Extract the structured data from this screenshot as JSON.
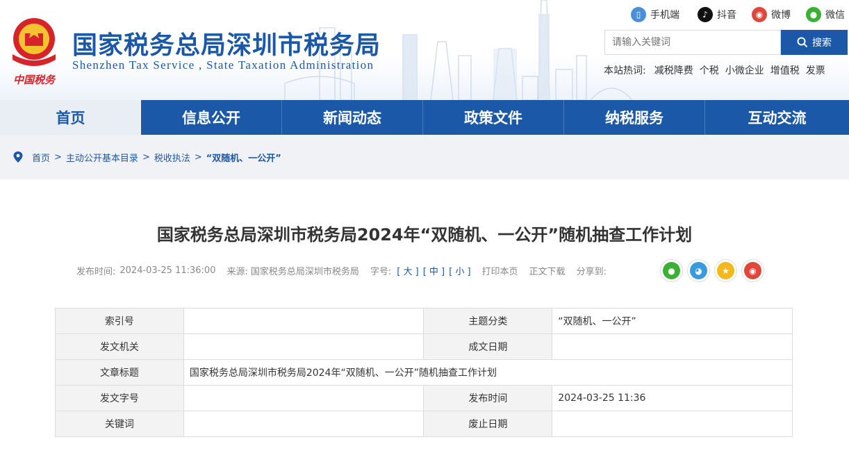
{
  "header": {
    "emblem_text": "中国税务",
    "site_name_cn": "国家税务总局深圳市税务局",
    "site_name_en": "Shenzhen  Tax  Service ,  State  Taxation  Administration",
    "social": [
      {
        "label": "手机端",
        "icon": "mobile-icon",
        "color": "#4a90d9"
      },
      {
        "label": "抖音",
        "icon": "douyin-icon",
        "color": "#111111"
      },
      {
        "label": "微博",
        "icon": "weibo-icon",
        "color": "#e0463a"
      },
      {
        "label": "微信",
        "icon": "wechat-icon",
        "color": "#3cb034"
      }
    ],
    "search": {
      "placeholder": "请输入关键词",
      "button_label": "搜索"
    },
    "hot": {
      "label": "本站热词:",
      "items": [
        "减税降费",
        "个税",
        "小微企业",
        "增值税",
        "发票"
      ]
    }
  },
  "nav": {
    "items": [
      "首页",
      "信息公开",
      "新闻动态",
      "政策文件",
      "纳税服务",
      "互动交流"
    ],
    "active_index": 0
  },
  "breadcrumb": {
    "items": [
      "首页",
      "主动公开基本目录",
      "税收执法",
      "“双随机、一公开”"
    ],
    "separator": ">"
  },
  "article": {
    "title": "国家税务总局深圳市税务局2024年“双随机、一公开”随机抽查工作计划",
    "publish_label": "发布时间:",
    "publish_time": "2024-03-25 11:36:00",
    "source_label": "来源:",
    "source": "国家税务总局深圳市税务局",
    "font_label": "字号:",
    "font_sizes": [
      "[ 大 ]",
      "[ 中 ]",
      "[ 小 ]"
    ],
    "print_label": "打印本页",
    "download_label": "正文下载",
    "share_label": "分享到:"
  },
  "info_table": {
    "index_label": "索引号",
    "index_value": "",
    "topic_label": "主题分类",
    "topic_value": "“双随机、一公开”",
    "issuer_label": "发文机关",
    "issuer_value": "",
    "created_label": "成文日期",
    "created_value": "",
    "title_label": "文章标题",
    "title_value": "国家税务总局深圳市税务局2024年“双随机、一公开”随机抽查工作计划",
    "docno_label": "发文字号",
    "docno_value": "",
    "pubtime_label": "发布时间",
    "pubtime_value": "2024-03-25 11:36",
    "keyword_label": "关键词",
    "keyword_value": "",
    "expire_label": "废止日期",
    "expire_value": ""
  },
  "colors": {
    "brand_blue": "#1b58a8",
    "nav_active_bg": "#e9edf4"
  }
}
